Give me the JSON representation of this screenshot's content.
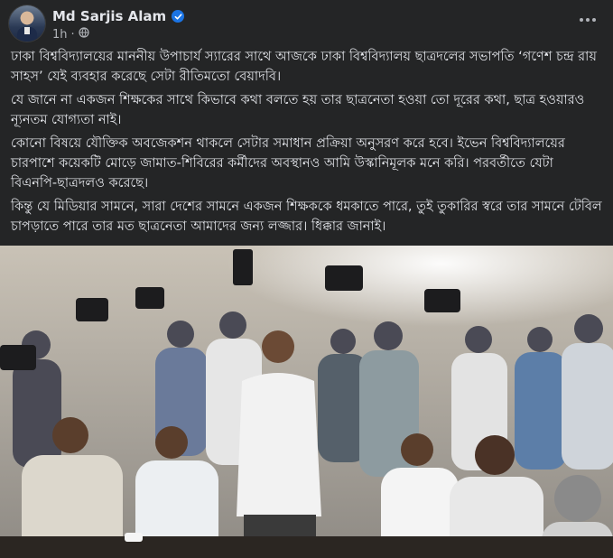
{
  "post": {
    "author": "Md Sarjis Alam",
    "time": "1h",
    "audience_icon": "globe-icon",
    "verified_icon": "verified-badge-icon",
    "more_icon": "more-options-icon",
    "paragraphs": [
      "ঢাকা বিশ্ববিদ্যালয়ের মাননীয় উপাচার্য স্যারের সাথে আজকে ঢাকা বিশ্ববিদ্যালয় ছাত্রদলের সভাপতি ‘গণেশ চন্দ্র রায় সাহস’ যেই ব্যবহার করেছে সেটা রীতিমতো বেয়াদবি।",
      "যে জানে না একজন শিক্ষকের সাথে কিভাবে কথা বলতে হয় তার ছাত্রনেতা হওয়া তো দূরের কথা, ছাত্র হওয়ারও ন্যূনতম যোগ্যতা নাই।",
      "কোনো বিষয়ে যৌক্তিক অবজেকশন থাকলে সেটার সমাধান প্রক্রিয়া অনুসরণ করে হবে। ইভেন বিশ্ববিদ্যালয়ের চারপাশে কয়েকটি মোড়ে জামাত-শিবিরের কর্মীদের অবস্থানও আমি উস্কানিমূলক মনে করি। পরবর্তীতে যেটা বিএনপি-ছাত্রদলও করেছে।",
      "কিন্তু যে মিডিয়ার সামনে, সারা দেশের সামনে একজন শিক্ষককে ধমকাতে পারে, তুই তুকারির স্বরে তার সামনে টেবিল চাপড়াতে পারে তার মত ছাত্রনেতা আমাদের জন্য লজ্জার। ধিক্কার জানাই।"
    ]
  },
  "colors": {
    "background": "#242526",
    "text": "#e4e6eb",
    "secondary_text": "#b0b3b8",
    "verified": "#1b74e4"
  }
}
